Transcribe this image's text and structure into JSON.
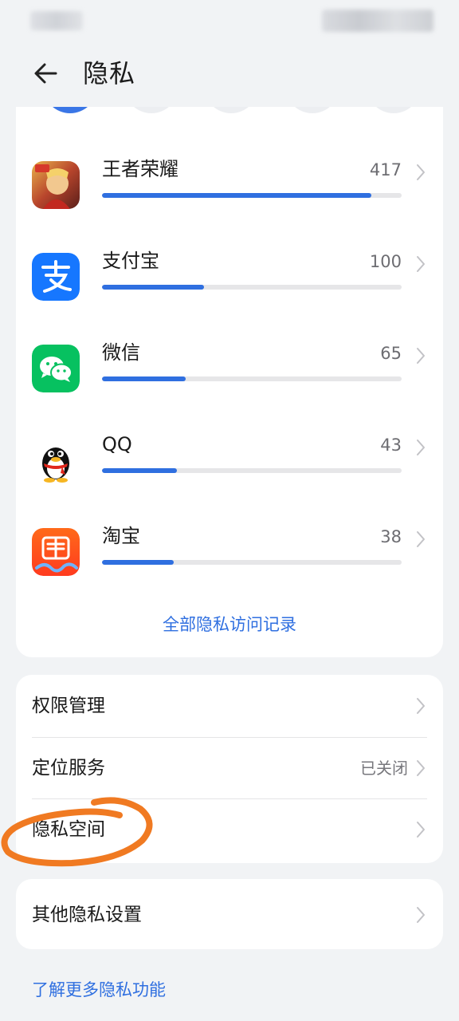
{
  "header": {
    "title": "隐私"
  },
  "apps": [
    {
      "name": "王者荣耀",
      "count": "417",
      "fraction": 0.9
    },
    {
      "name": "支付宝",
      "count": "100",
      "fraction": 0.34
    },
    {
      "name": "微信",
      "count": "65",
      "fraction": 0.28
    },
    {
      "name": "QQ",
      "count": "43",
      "fraction": 0.25
    },
    {
      "name": "淘宝",
      "count": "38",
      "fraction": 0.24
    }
  ],
  "all_records_link": "全部隐私访问记录",
  "settings": [
    {
      "label": "权限管理",
      "value": ""
    },
    {
      "label": "定位服务",
      "value": "已关闭"
    },
    {
      "label": "隐私空间",
      "value": ""
    }
  ],
  "other_settings": "其他隐私设置",
  "learn_more": "了解更多隐私功能",
  "colors": {
    "accent": "#2f6fe0",
    "annotation": "#f07a22"
  }
}
